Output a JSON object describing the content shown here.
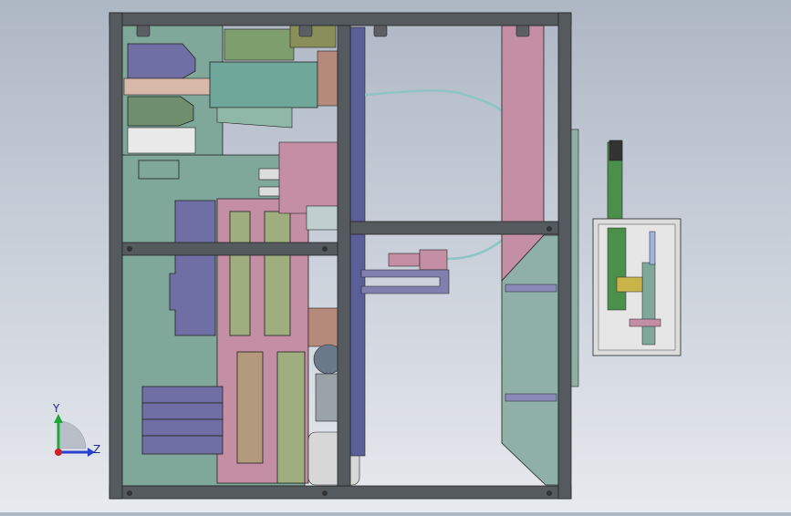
{
  "viewport": {
    "background_top": "#aeb7c4",
    "background_bottom": "#e7eaee"
  },
  "triad": {
    "y_label": "Y",
    "z_label": "Z",
    "y_color": "#1fa83a",
    "z_color": "#2a3fd0",
    "origin_color": "#d0202a"
  },
  "colors": {
    "frame": "#555a5e",
    "frame_edge": "#222",
    "teal_plate": "#7fa79a",
    "purple_block": "#6f6fa6",
    "pink_plate": "#c48ea5",
    "olive_slot": "#9fae7e",
    "tan_slot": "#b39a7c",
    "green_panel": "#4a8f4a"
  }
}
